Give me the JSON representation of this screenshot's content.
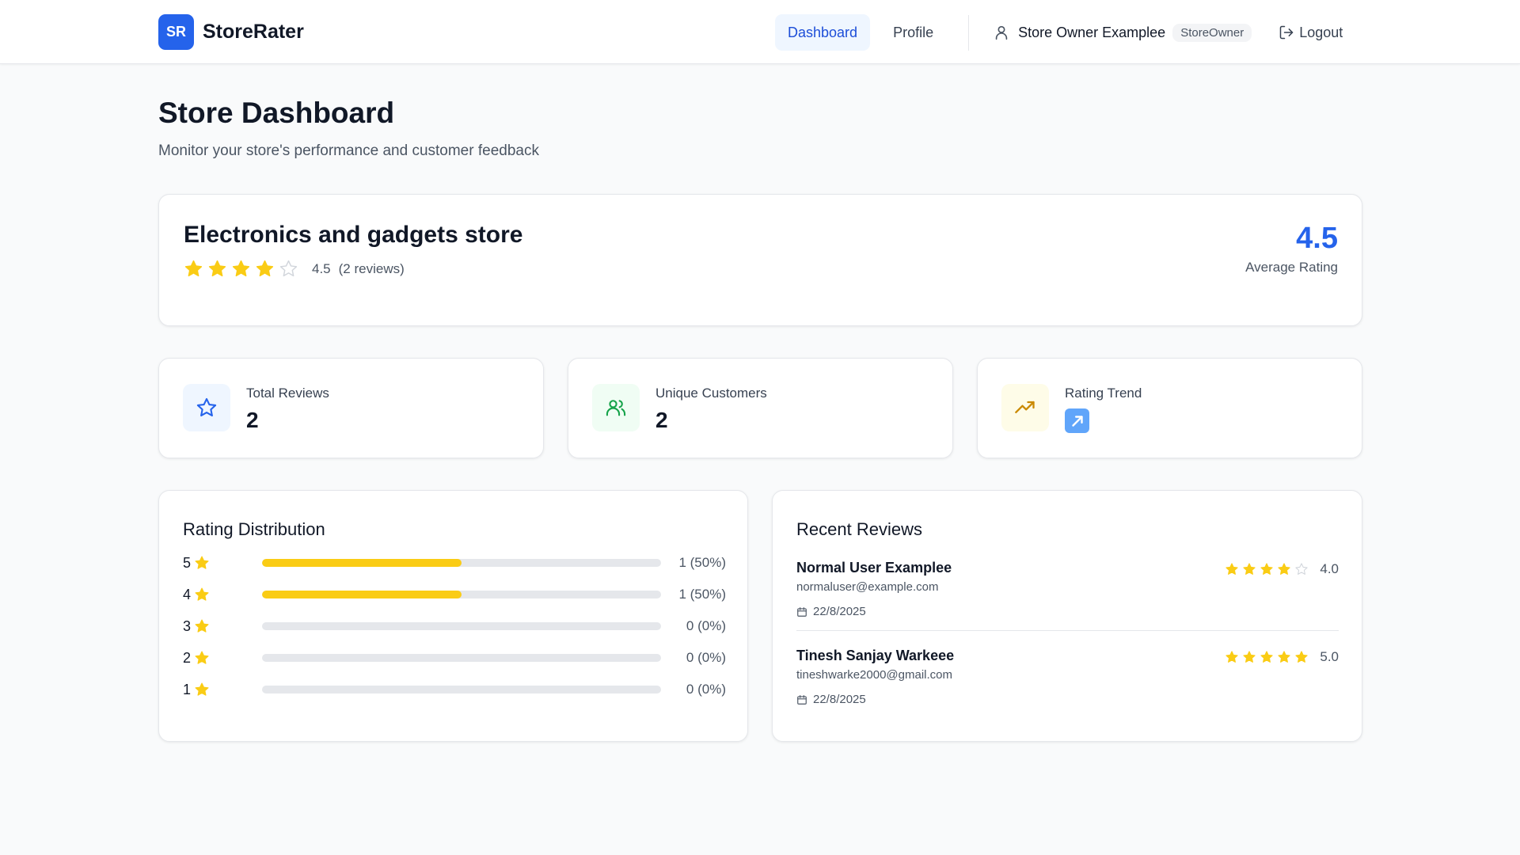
{
  "header": {
    "logo_text": "SR",
    "brand_name": "StoreRater",
    "nav": [
      {
        "label": "Dashboard",
        "active": true
      },
      {
        "label": "Profile",
        "active": false
      }
    ],
    "user_name": "Store Owner Examplee",
    "role": "StoreOwner",
    "logout_label": "Logout",
    "user_icon": "user-icon",
    "logout_icon": "logout-icon"
  },
  "page": {
    "title": "Store Dashboard",
    "subtitle": "Monitor your store's performance and customer feedback"
  },
  "store": {
    "name": "Electronics and gadgets store",
    "rating": 4.5,
    "rating_text": "4.5",
    "review_count_text": "(2 reviews)",
    "average_value": "4.5",
    "average_label": "Average Rating"
  },
  "stats": [
    {
      "label": "Total Reviews",
      "value": "2",
      "icon": "star-icon",
      "icon_bg": "#eff6ff",
      "icon_color": "#2563eb"
    },
    {
      "label": "Unique Customers",
      "value": "2",
      "icon": "users-icon",
      "icon_bg": "#f0fdf4",
      "icon_color": "#16a34a"
    },
    {
      "label": "Rating Trend",
      "value": "↗",
      "icon": "trending-up-icon",
      "icon_bg": "#fefce8",
      "icon_color": "#ca8a04"
    }
  ],
  "distribution": {
    "title": "Rating Distribution",
    "rows": [
      {
        "stars": "5",
        "fraction": 0.5,
        "count_text": "1 (50%)"
      },
      {
        "stars": "4",
        "fraction": 0.5,
        "count_text": "1 (50%)"
      },
      {
        "stars": "3",
        "fraction": 0,
        "count_text": "0 (0%)"
      },
      {
        "stars": "2",
        "fraction": 0,
        "count_text": "0 (0%)"
      },
      {
        "stars": "1",
        "fraction": 0,
        "count_text": "0 (0%)"
      }
    ]
  },
  "recent_reviews": {
    "title": "Recent Reviews",
    "items": [
      {
        "name": "Normal User Examplee",
        "email": "normaluser@example.com",
        "date": "22/8/2025",
        "rating": 4,
        "rating_text": "4.0"
      },
      {
        "name": "Tinesh Sanjay Warkeee",
        "email": "tineshwarke2000@gmail.com",
        "date": "22/8/2025",
        "rating": 5,
        "rating_text": "5.0"
      }
    ]
  },
  "colors": {
    "accent": "#2563eb",
    "star_filled": "#facc15",
    "star_empty": "#d1d5db",
    "bar_fill": "#facc15",
    "bar_track": "#e5e7eb"
  }
}
